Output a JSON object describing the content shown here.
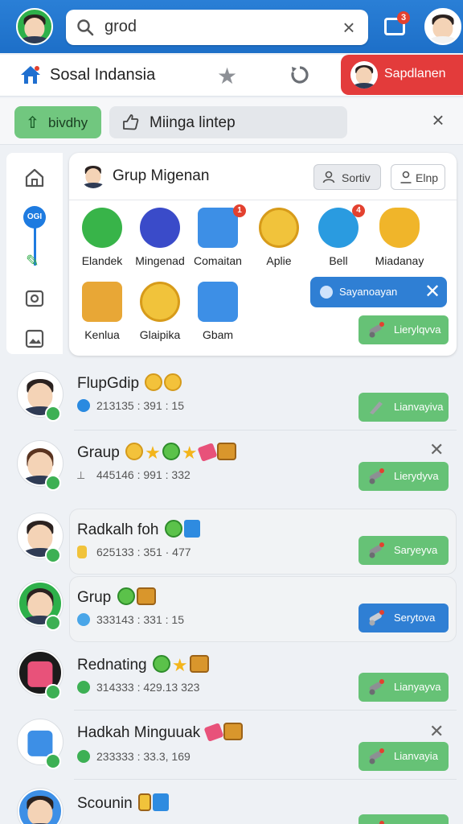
{
  "colors": {
    "topbar": "#1d6fc8",
    "accent_green": "#66c276",
    "accent_blue": "#2f7fd4",
    "danger_red": "#e33b3b"
  },
  "topbar": {
    "search": {
      "value": "grod",
      "search_icon": "search-icon",
      "clear_icon": "close-icon"
    },
    "notifications": {
      "icon": "calendar-notification-icon",
      "count": "3"
    }
  },
  "nav": {
    "home_icon": "home-icon",
    "title": "Sosal Indansia",
    "star_icon": "star-icon",
    "refresh_icon": "refresh-icon",
    "profile_button": "Sapdlanen"
  },
  "filters": {
    "chip_green": "bivdhy",
    "chip_gray": "Miinga lintep",
    "close": "×"
  },
  "siderail": {
    "badge": "OGI"
  },
  "group": {
    "title": "Grup Migenan",
    "sort_label": "Sortiv",
    "elnp_label": "Elnp",
    "apps": [
      {
        "label": "Elandek",
        "icon": "woman-avatar-icon"
      },
      {
        "label": "Mingenad",
        "icon": "notepad-icon"
      },
      {
        "label": "Comaitan",
        "icon": "gift-box-icon",
        "badge": "1"
      },
      {
        "label": "Aplie",
        "icon": "gold-coin-icon"
      },
      {
        "label": "Bell",
        "icon": "book-gear-icon",
        "badge": "4"
      },
      {
        "label": "Miadanay",
        "icon": "trophy-icon"
      },
      {
        "label": "Kenlua",
        "icon": "game-board-icon"
      },
      {
        "label": "Glaipika",
        "icon": "gold-coin-icon"
      },
      {
        "label": "Gbam",
        "icon": "gift-box-icon"
      }
    ],
    "sayan_button": "Sayanoayan",
    "action_button": "Lierylqvva"
  },
  "chats": [
    {
      "name": "FlupGdip",
      "meta": "213135 : 391 : 15",
      "button": "Lianvayiva",
      "button_style": "green"
    },
    {
      "name": "Graup",
      "meta": "445146 : 991 : 332",
      "button": "Lierydyva",
      "button_style": "green",
      "closable": true
    },
    {
      "name": "Radkalh  foh",
      "meta": "625133 : 351 · 477",
      "button": "Saryeyva",
      "button_style": "green"
    },
    {
      "name": "Grup",
      "meta": "333143 : 331 : 15",
      "button": "Serytova",
      "button_style": "blue"
    },
    {
      "name": "Rednating",
      "meta": "314333 : 429.13 323",
      "button": "Lianyayva",
      "button_style": "green"
    },
    {
      "name": "Hadkah Minguuak",
      "meta": "233333 : 33.3, 169",
      "button": "Lianvayia",
      "button_style": "green",
      "closable": true
    },
    {
      "name": "Scounin",
      "meta": "",
      "button": "",
      "button_style": "green"
    }
  ]
}
